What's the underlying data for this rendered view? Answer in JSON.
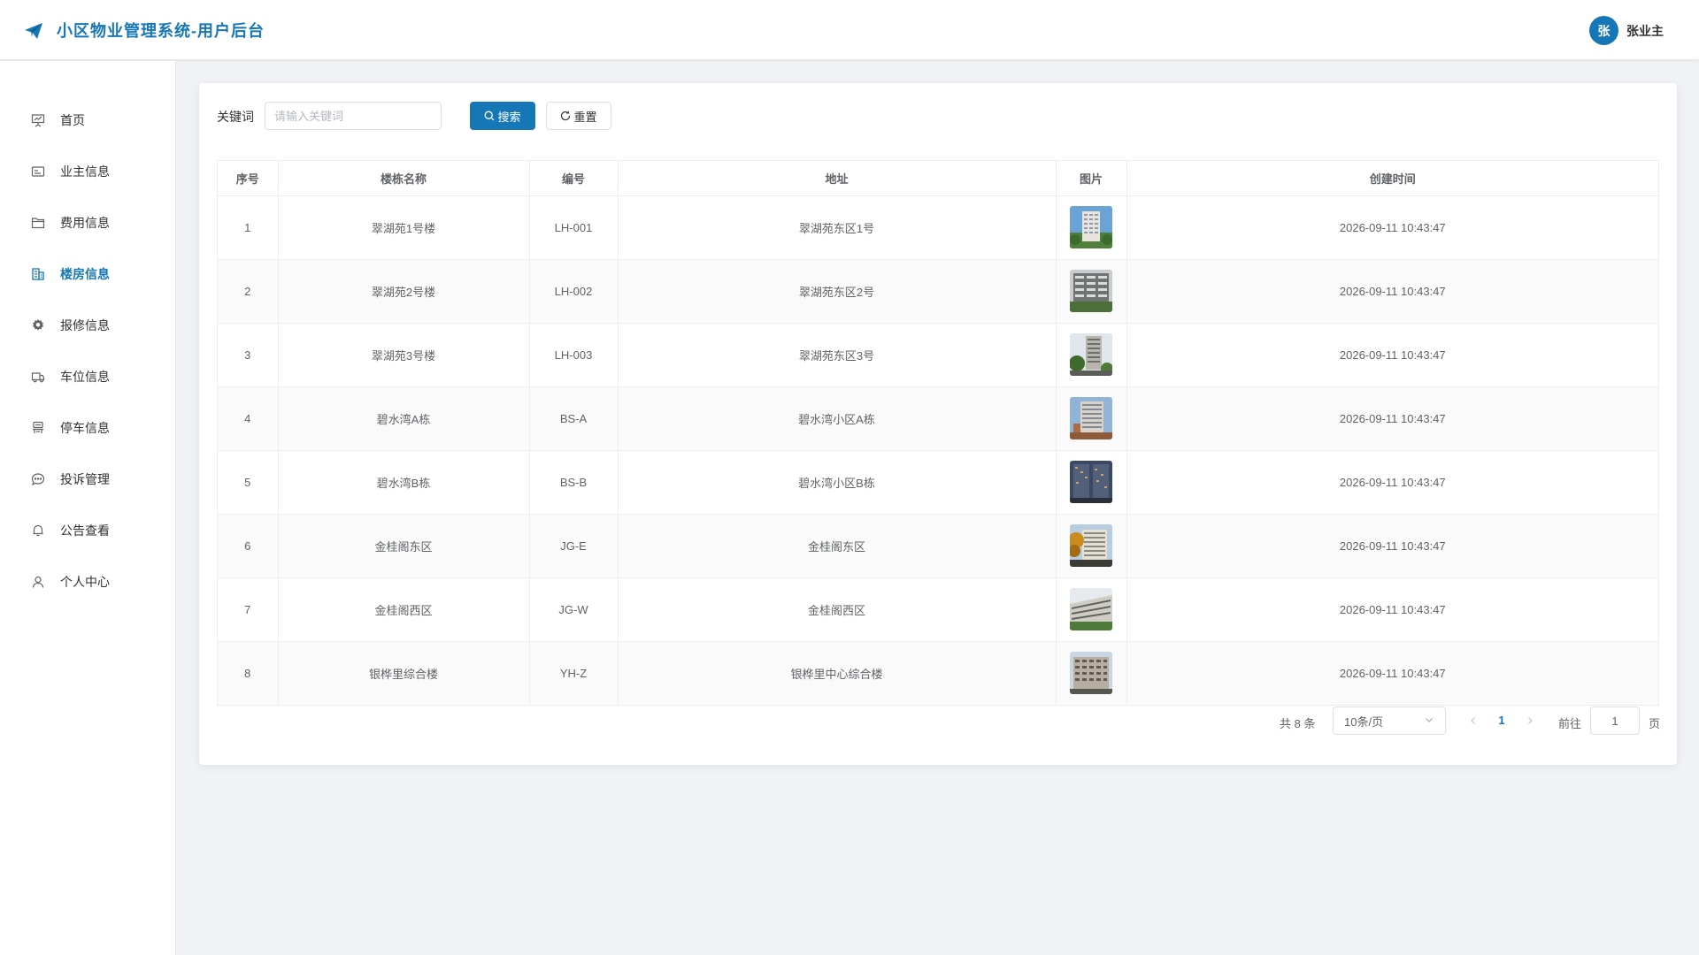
{
  "header": {
    "title": "小区物业管理系统-用户后台",
    "avatar_char": "张",
    "user_name": "张业主",
    "brand_color": "#1677b7"
  },
  "sidebar": {
    "items": [
      {
        "label": "首页",
        "icon": "presentation-icon",
        "active": false
      },
      {
        "label": "业主信息",
        "icon": "id-card-icon",
        "active": false
      },
      {
        "label": "费用信息",
        "icon": "folder-icon",
        "active": false
      },
      {
        "label": "楼房信息",
        "icon": "building-icon",
        "active": true
      },
      {
        "label": "报修信息",
        "icon": "gear-icon",
        "active": false
      },
      {
        "label": "车位信息",
        "icon": "truck-icon",
        "active": false
      },
      {
        "label": "停车信息",
        "icon": "parking-icon",
        "active": false
      },
      {
        "label": "投诉管理",
        "icon": "chat-icon",
        "active": false
      },
      {
        "label": "公告查看",
        "icon": "bell-icon",
        "active": false
      },
      {
        "label": "个人中心",
        "icon": "user-icon",
        "active": false
      }
    ]
  },
  "search": {
    "label": "关键词",
    "placeholder": "请输入关键词",
    "value": "",
    "search_button": "搜索",
    "reset_button": "重置"
  },
  "table": {
    "headers": [
      "序号",
      "楼栋名称",
      "编号",
      "地址",
      "图片",
      "创建时间"
    ],
    "rows": [
      {
        "index": "1",
        "name": "翠湖苑1号楼",
        "code": "LH-001",
        "address": "翠湖苑东区1号",
        "created": "2026-09-11 10:43:47"
      },
      {
        "index": "2",
        "name": "翠湖苑2号楼",
        "code": "LH-002",
        "address": "翠湖苑东区2号",
        "created": "2026-09-11 10:43:47"
      },
      {
        "index": "3",
        "name": "翠湖苑3号楼",
        "code": "LH-003",
        "address": "翠湖苑东区3号",
        "created": "2026-09-11 10:43:47"
      },
      {
        "index": "4",
        "name": "碧水湾A栋",
        "code": "BS-A",
        "address": "碧水湾小区A栋",
        "created": "2026-09-11 10:43:47"
      },
      {
        "index": "5",
        "name": "碧水湾B栋",
        "code": "BS-B",
        "address": "碧水湾小区B栋",
        "created": "2026-09-11 10:43:47"
      },
      {
        "index": "6",
        "name": "金桂阁东区",
        "code": "JG-E",
        "address": "金桂阁东区",
        "created": "2026-09-11 10:43:47"
      },
      {
        "index": "7",
        "name": "金桂阁西区",
        "code": "JG-W",
        "address": "金桂阁西区",
        "created": "2026-09-11 10:43:47"
      },
      {
        "index": "8",
        "name": "银桦里综合楼",
        "code": "YH-Z",
        "address": "银桦里中心综合楼",
        "created": "2026-09-11 10:43:47"
      }
    ]
  },
  "pagination": {
    "total_text": "共 8 条",
    "page_size": "10条/页",
    "current_page": "1",
    "goto_label": "前往",
    "goto_value": "1",
    "goto_suffix": "页"
  }
}
